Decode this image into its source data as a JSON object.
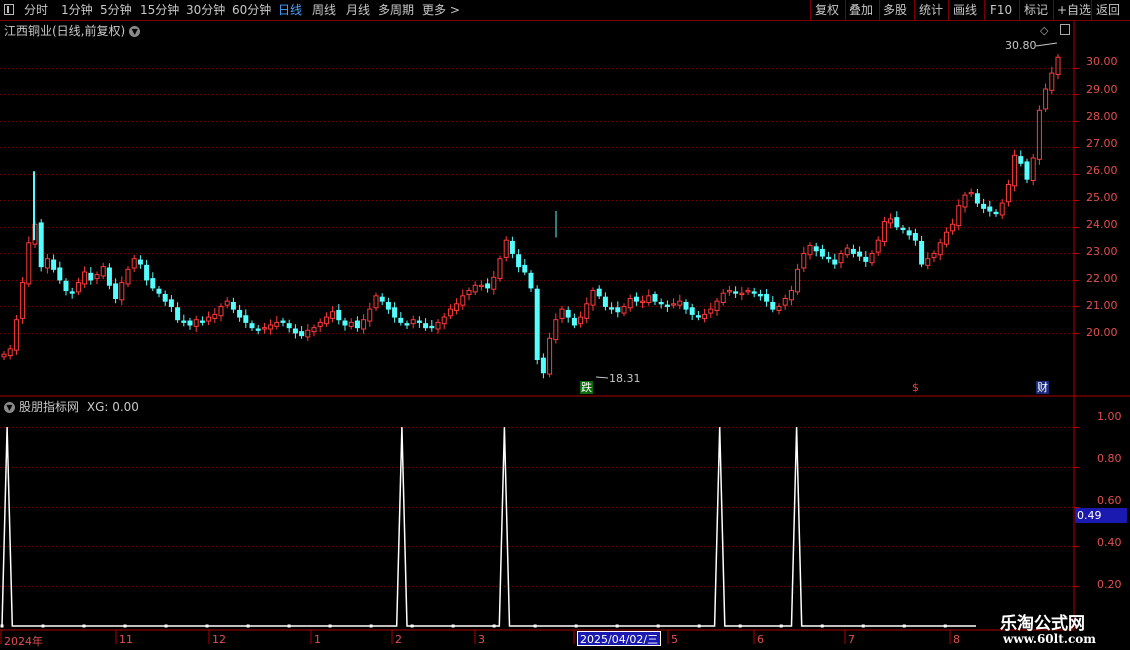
{
  "toolbar": {
    "periods": [
      "分时",
      "1分钟",
      "5分钟",
      "15分钟",
      "30分钟",
      "60分钟",
      "日线",
      "周线",
      "月线",
      "多周期",
      "更多 >"
    ],
    "active_period": "日线",
    "actions": [
      "复权",
      "叠加",
      "多股",
      "统计",
      "画线",
      "F10",
      "+自选",
      "返回"
    ]
  },
  "main_panel": {
    "title": "江西铜业(日线,前复权)",
    "high_label": "30.80",
    "low_label": "18.31",
    "markers": {
      "die": "跌",
      "dollar": "$",
      "cai": "财"
    },
    "y_ticks": [
      "30.00",
      "29.00",
      "28.00",
      "27.00",
      "26.00",
      "25.00",
      "24.00",
      "23.00",
      "22.00",
      "21.00",
      "20.00"
    ]
  },
  "indicator_panel": {
    "title": "股朋指标网",
    "value_label": "XG: 0.00",
    "y_ticks": [
      "1.00",
      "0.80",
      "0.60",
      "0.40",
      "0.20"
    ],
    "cursor_value": "0.49"
  },
  "date_axis": {
    "labels": [
      "2024年",
      "11",
      "12",
      "1",
      "2",
      "3",
      "5",
      "6",
      "7",
      "8"
    ],
    "cursor_date": "2025/04/02/三"
  },
  "watermark": {
    "title": "乐淘公式网",
    "url": "www.60lt.com"
  },
  "colors": {
    "up": "#ff3b3b",
    "down": "#54ffff",
    "indicator": "#ffffff",
    "grid": "#7a0000"
  },
  "chart_data": [
    {
      "type": "candlestick",
      "title": "江西铜业(日线,前复权)",
      "ylim": [
        18.0,
        31.2
      ],
      "y_ticks": [
        20,
        21,
        22,
        23,
        24,
        25,
        26,
        27,
        28,
        29,
        30
      ],
      "annotations": {
        "high": 30.8,
        "low": 18.31
      },
      "closes": [
        19.2,
        19.4,
        20.5,
        21.9,
        23.4,
        24.1,
        22.5,
        22.8,
        22.4,
        22.0,
        21.6,
        21.5,
        21.9,
        22.3,
        22.0,
        22.2,
        22.5,
        21.8,
        21.3,
        21.9,
        22.4,
        22.8,
        22.6,
        22.0,
        21.7,
        21.5,
        21.2,
        21.0,
        20.5,
        20.4,
        20.3,
        20.5,
        20.4,
        20.6,
        20.7,
        21.0,
        21.2,
        20.9,
        20.6,
        20.4,
        20.2,
        20.1,
        20.2,
        20.3,
        20.4,
        20.4,
        20.2,
        20.0,
        19.9,
        20.1,
        20.2,
        20.4,
        20.6,
        20.8,
        20.5,
        20.3,
        20.4,
        20.2,
        20.5,
        20.9,
        21.4,
        21.2,
        20.9,
        20.6,
        20.4,
        20.3,
        20.5,
        20.4,
        20.2,
        20.2,
        20.4,
        20.6,
        20.9,
        21.1,
        21.4,
        21.6,
        21.8,
        21.8,
        21.7,
        22.1,
        22.8,
        23.5,
        23.0,
        22.5,
        22.3,
        21.7,
        19.0,
        18.5,
        19.8,
        20.5,
        20.9,
        20.6,
        20.3,
        20.6,
        21.1,
        21.6,
        21.4,
        21.0,
        20.9,
        20.8,
        21.0,
        21.3,
        21.2,
        21.2,
        21.4,
        21.2,
        21.1,
        21.0,
        21.1,
        21.2,
        20.9,
        20.7,
        20.6,
        20.7,
        20.9,
        21.2,
        21.5,
        21.6,
        21.5,
        21.5,
        21.6,
        21.5,
        21.4,
        21.2,
        20.9,
        21.0,
        21.3,
        21.6,
        22.4,
        23.0,
        23.3,
        23.1,
        22.9,
        22.8,
        22.6,
        23.0,
        23.2,
        23.0,
        22.9,
        22.7,
        23.0,
        23.5,
        24.2,
        24.3,
        24.0,
        23.9,
        23.7,
        23.5,
        22.6,
        22.8,
        23.0,
        23.4,
        23.8,
        24.1,
        24.8,
        25.2,
        25.3,
        24.9,
        24.7,
        24.6,
        24.5,
        24.9,
        25.6,
        26.7,
        26.4,
        25.8,
        26.6,
        28.4,
        29.2,
        29.8,
        30.4
      ],
      "spikes": [
        26.1,
        24.6
      ]
    },
    {
      "type": "line",
      "title": "股朋指标网",
      "ylim": [
        0,
        1.05
      ],
      "y_ticks": [
        0.2,
        0.4,
        0.6,
        0.8,
        1.0
      ],
      "series": [
        {
          "name": "XG",
          "values": [
            0,
            1,
            0,
            0,
            0,
            0,
            0,
            0,
            0,
            0,
            0,
            0,
            0,
            0,
            0,
            0,
            0,
            0,
            0,
            0,
            0,
            0,
            0,
            0,
            0,
            0,
            0,
            0,
            0,
            0,
            0,
            0,
            0,
            0,
            0,
            0,
            0,
            0,
            0,
            0,
            0,
            0,
            0,
            0,
            0,
            0,
            0,
            0,
            0,
            0,
            0,
            0,
            0,
            0,
            0,
            0,
            0,
            0,
            0,
            0,
            0,
            0,
            0,
            0,
            0,
            0,
            0,
            0,
            0,
            0,
            0,
            0,
            0,
            0,
            0,
            0,
            0,
            0,
            1,
            0,
            0,
            0,
            0,
            0,
            0,
            0,
            0,
            0,
            0,
            0,
            0,
            0,
            0,
            0,
            0,
            0,
            0,
            0,
            1,
            0,
            0,
            0,
            0,
            0,
            0,
            0,
            0,
            0,
            0,
            0,
            0,
            0,
            0,
            0,
            0,
            0,
            0,
            0,
            0,
            0,
            0,
            0,
            0,
            0,
            0,
            0,
            0,
            0,
            0,
            0,
            0,
            0,
            0,
            0,
            0,
            0,
            0,
            0,
            0,
            0,
            1,
            0,
            0,
            0,
            0,
            0,
            0,
            0,
            0,
            0,
            0,
            0,
            0,
            0,
            0,
            1,
            0,
            0,
            0,
            0,
            0,
            0,
            0,
            0,
            0,
            0,
            0,
            0,
            0,
            0,
            0,
            0,
            0,
            0,
            0,
            0,
            0,
            0,
            0,
            0,
            0,
            0,
            0,
            0,
            0,
            0,
            0,
            0,
            0,
            0,
            0
          ]
        }
      ]
    }
  ]
}
